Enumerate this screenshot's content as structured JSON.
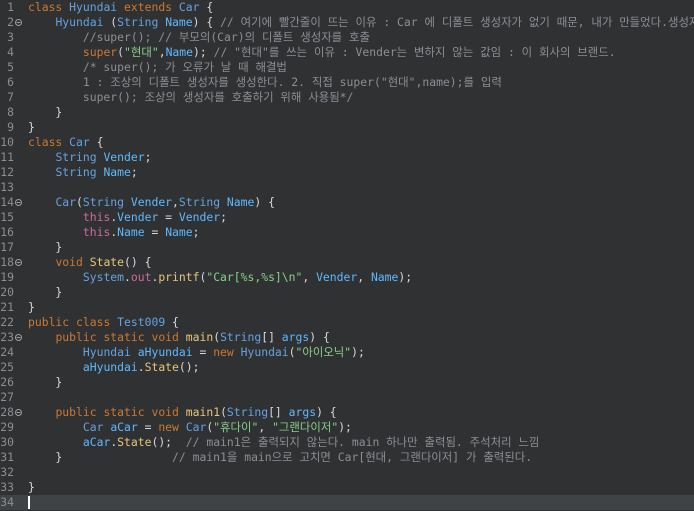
{
  "editor": {
    "lines": [
      {
        "n": "1",
        "fold": "",
        "code": "class Hyundai extends Car {"
      },
      {
        "n": "2",
        "fold": "⊖",
        "code": "    Hyundai (String Name) { // 여기에 빨간줄이 뜨는 이유 : Car 에 디폴트 생성자가 없기 때문, 내가 만들었다.생성자"
      },
      {
        "n": "3",
        "fold": "",
        "code": "        //super(); // 부모의(Car)의 디폴트 생성자를 호출"
      },
      {
        "n": "4",
        "fold": "",
        "code": "        super(\"현대\",Name); // \"현대\"를 쓰는 이유 : Vender는 변하지 않는 값임 : 이 회사의 브랜드."
      },
      {
        "n": "5",
        "fold": "",
        "code": "        /* super(); 가 오류가 날 때 해결법"
      },
      {
        "n": "6",
        "fold": "",
        "code": "        1 : 조상의 디폴트 생성자를 생성한다. 2. 직접 super(\"현대\",name);를 입력"
      },
      {
        "n": "7",
        "fold": "",
        "code": "        super(); 조상의 생성자를 호출하기 위해 사용됨*/"
      },
      {
        "n": "8",
        "fold": "",
        "code": "    }"
      },
      {
        "n": "9",
        "fold": "",
        "code": "}"
      },
      {
        "n": "10",
        "fold": "",
        "code": "class Car {"
      },
      {
        "n": "11",
        "fold": "",
        "code": "    String Vender;"
      },
      {
        "n": "12",
        "fold": "",
        "code": "    String Name;"
      },
      {
        "n": "13",
        "fold": "",
        "code": ""
      },
      {
        "n": "14",
        "fold": "⊖",
        "code": "    Car(String Vender,String Name) {"
      },
      {
        "n": "15",
        "fold": "",
        "code": "        this.Vender = Vender;"
      },
      {
        "n": "16",
        "fold": "",
        "code": "        this.Name = Name;"
      },
      {
        "n": "17",
        "fold": "",
        "code": "    }"
      },
      {
        "n": "18",
        "fold": "⊖",
        "code": "    void State() {"
      },
      {
        "n": "19",
        "fold": "",
        "code": "        System.out.printf(\"Car[%s,%s]\\n\", Vender, Name);"
      },
      {
        "n": "20",
        "fold": "",
        "code": "    }"
      },
      {
        "n": "21",
        "fold": "",
        "code": "}"
      },
      {
        "n": "22",
        "fold": "",
        "code": "public class Test009 {"
      },
      {
        "n": "23",
        "fold": "⊖",
        "code": "    public static void main(String[] args) {"
      },
      {
        "n": "24",
        "fold": "",
        "code": "        Hyundai aHyundai = new Hyundai(\"아이오닉\");"
      },
      {
        "n": "25",
        "fold": "",
        "code": "        aHyundai.State();"
      },
      {
        "n": "26",
        "fold": "",
        "code": "    }"
      },
      {
        "n": "27",
        "fold": "",
        "code": ""
      },
      {
        "n": "28",
        "fold": "⊖",
        "code": "    public static void main1(String[] args) {"
      },
      {
        "n": "29",
        "fold": "",
        "code": "        Car aCar = new Car(\"휴다이\", \"그랜다이저\");"
      },
      {
        "n": "30",
        "fold": "",
        "code": "        aCar.State();  // main1은 출력되지 않는다. main 하나만 출력됨. 주석처리 느낌"
      },
      {
        "n": "31",
        "fold": "",
        "code": "    }                // main1을 main으로 고치면 Car[현대, 그랜다이저] 가 출력된다."
      },
      {
        "n": "32",
        "fold": "",
        "code": ""
      },
      {
        "n": "33",
        "fold": "",
        "code": "}"
      },
      {
        "n": "34",
        "fold": "",
        "code": ""
      }
    ],
    "current_line": "34",
    "colors": {
      "background": "#2f3133",
      "current_line": "#3f4346",
      "keyword": "#cc7832",
      "type": "#66a2e0",
      "string": "#8ad08a",
      "comment": "#8b8f95"
    }
  }
}
